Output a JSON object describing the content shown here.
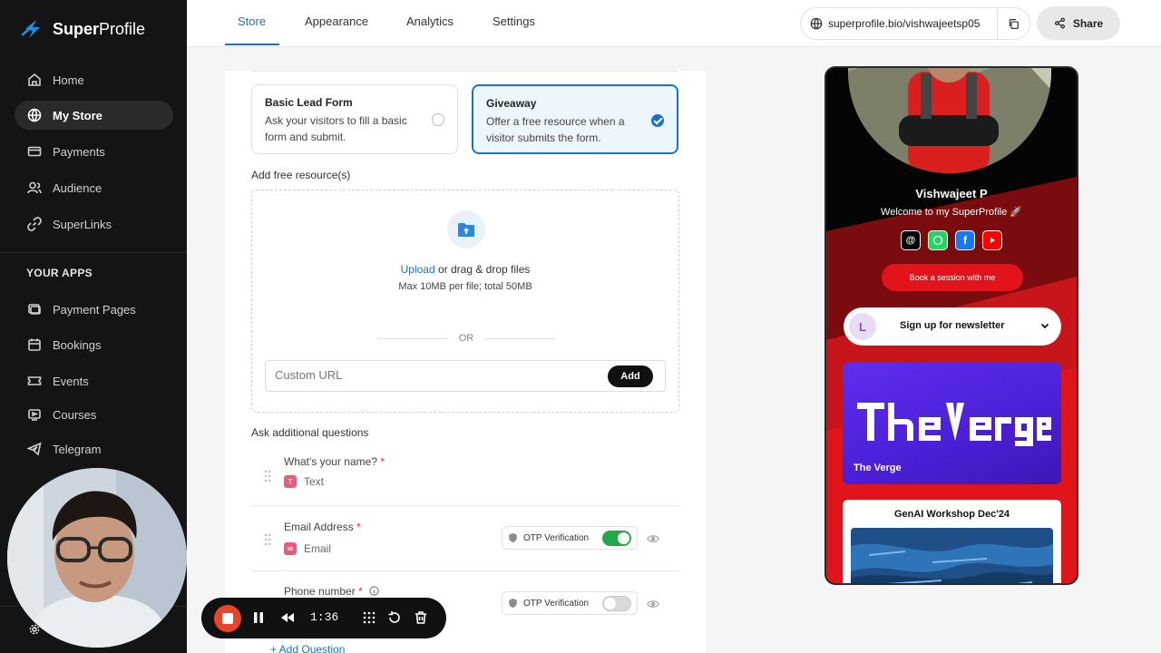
{
  "brand": {
    "name": "SuperProfile",
    "name_prefix": "Super",
    "name_suffix": "Profile"
  },
  "sidebar": {
    "items": [
      {
        "label": "Home",
        "icon": "home-icon",
        "active": false
      },
      {
        "label": "My Store",
        "icon": "globe-icon",
        "active": true
      },
      {
        "label": "Payments",
        "icon": "payments-icon",
        "active": false
      },
      {
        "label": "Audience",
        "icon": "audience-icon",
        "active": false
      },
      {
        "label": "SuperLinks",
        "icon": "link-icon",
        "active": false
      }
    ],
    "apps_label": "YOUR APPS",
    "apps": [
      {
        "label": "Payment Pages",
        "icon": "payment-pages-icon"
      },
      {
        "label": "Bookings",
        "icon": "calendar-icon"
      },
      {
        "label": "Events",
        "icon": "ticket-icon"
      },
      {
        "label": "Courses",
        "icon": "courses-icon"
      },
      {
        "label": "Telegram",
        "icon": "telegram-icon"
      }
    ]
  },
  "tabs": [
    {
      "label": "Store",
      "active": true
    },
    {
      "label": "Appearance",
      "active": false
    },
    {
      "label": "Analytics",
      "active": false
    },
    {
      "label": "Settings",
      "active": false
    }
  ],
  "header": {
    "url": "superprofile.bio/vishwajeetsp05",
    "share_label": "Share"
  },
  "form_types": [
    {
      "title": "Basic Lead Form",
      "desc": "Ask your visitors to fill a basic form and submit.",
      "selected": false
    },
    {
      "title": "Giveaway",
      "desc": "Offer a free resource when a visitor submits the form.",
      "selected": true
    }
  ],
  "resources": {
    "label": "Add free resource(s)",
    "upload_link": "Upload",
    "upload_text": " or drag & drop files",
    "limits": "Max 10MB per file; total 50MB",
    "or": "OR",
    "url_placeholder": "Custom URL",
    "add_label": "Add"
  },
  "questions": {
    "label": "Ask additional questions",
    "items": [
      {
        "title": "What's your name?",
        "required_mark": "*",
        "type": "Text",
        "otp": null
      },
      {
        "title": "Email Address",
        "required_mark": "*",
        "type": "Email",
        "otp": {
          "label": "OTP Verification",
          "on": true
        }
      },
      {
        "title": "Phone number",
        "required_mark": "*",
        "type": "",
        "otp": {
          "label": "OTP Verification",
          "on": false
        }
      }
    ],
    "add_label": "+ Add Question"
  },
  "preview": {
    "name": "Vishwajeet P",
    "bio": "Welcome to my SuperProfile 🚀",
    "book_label": "Book a session with me",
    "newsletter_label": "Sign up for newsletter",
    "verge_title": "The Verge",
    "workshop_title": "GenAI Workshop Dec'24"
  },
  "recorder": {
    "time": "1:36"
  },
  "colors": {
    "accent": "#1a73c9",
    "sidebar_bg": "#141414",
    "toggle_on": "#22a94a",
    "rec_red": "#e8432b"
  }
}
